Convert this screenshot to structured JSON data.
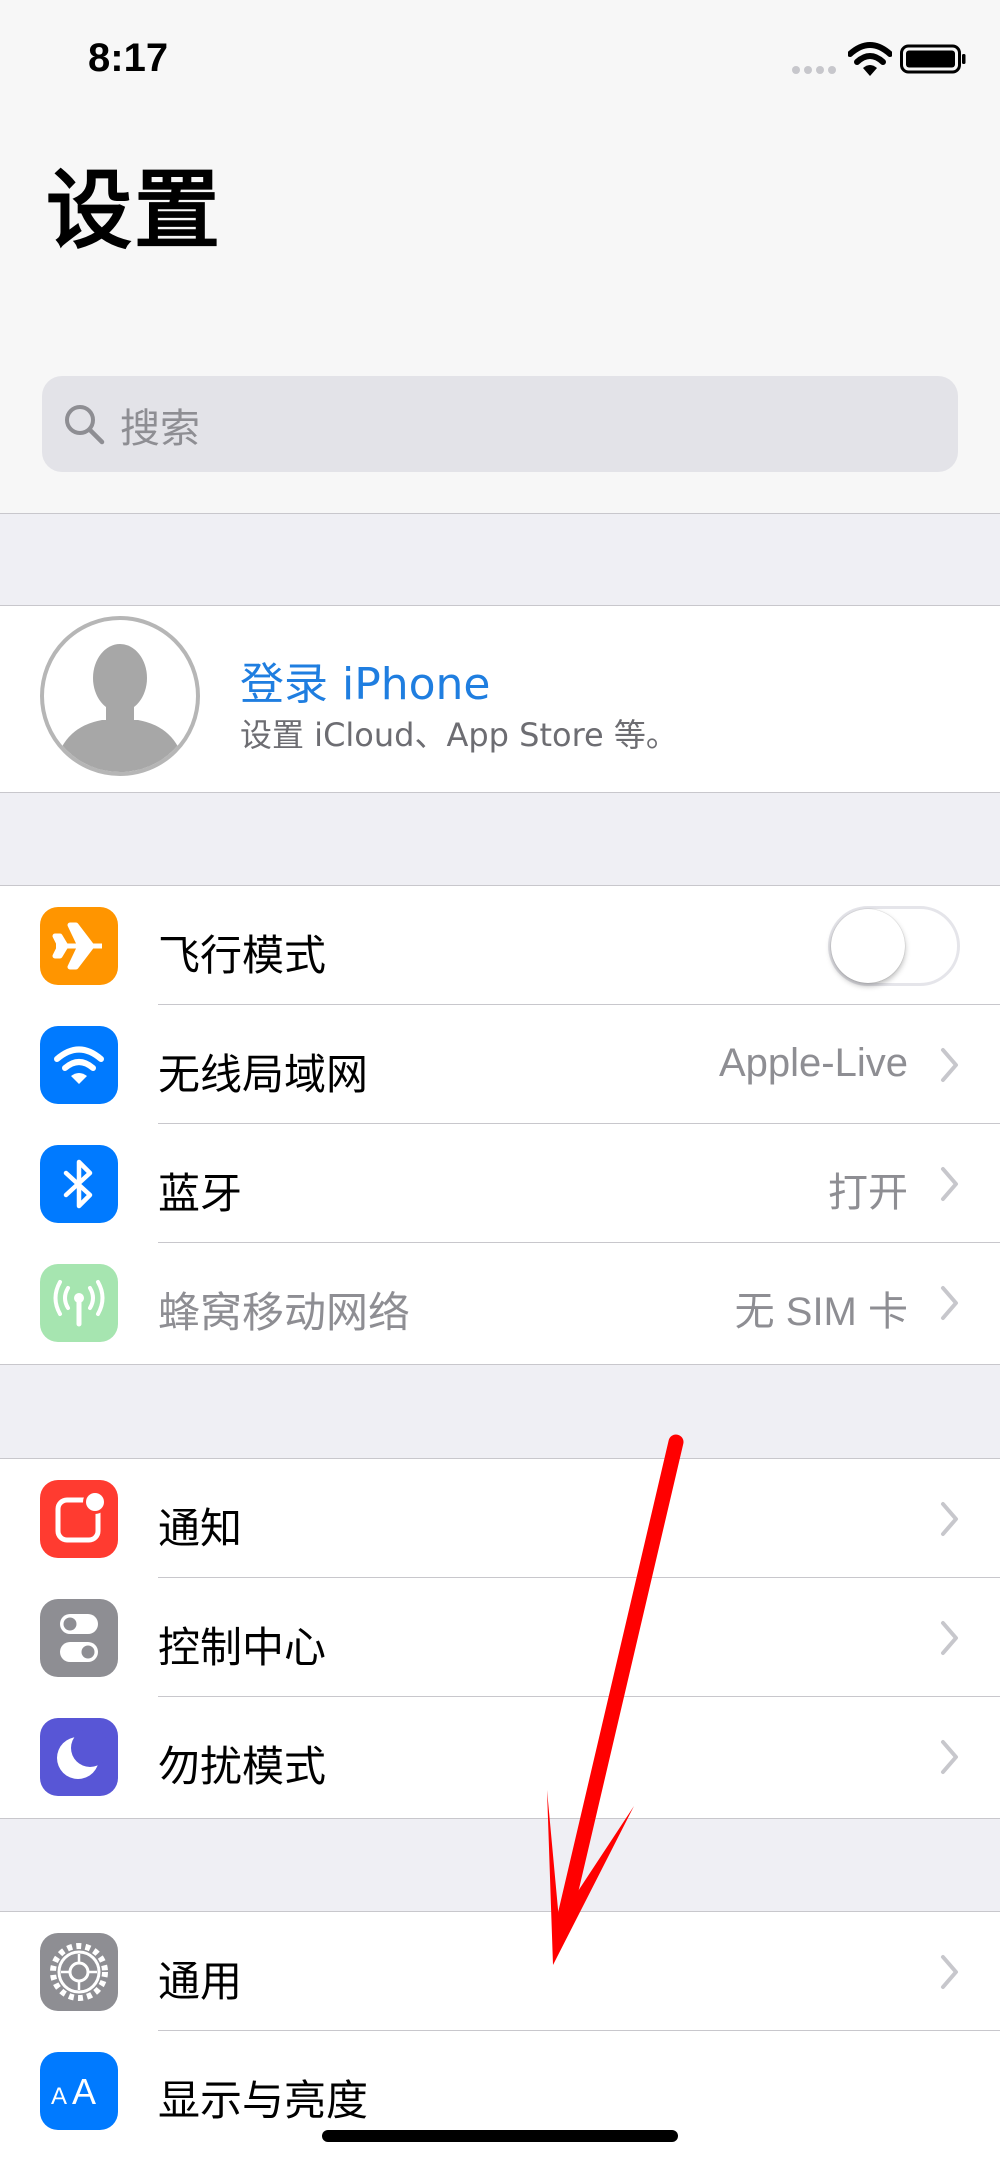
{
  "status_bar": {
    "time": "8:17"
  },
  "header": {
    "title": "设置"
  },
  "search": {
    "placeholder": "搜索"
  },
  "profile": {
    "title": "登录 iPhone",
    "subtitle": "设置 iCloud、App Store 等。"
  },
  "connectivity": [
    {
      "label": "飞行模式",
      "icon": "airplane-icon",
      "color": "#ff9500",
      "toggle_on": false
    },
    {
      "label": "无线局域网",
      "icon": "wifi-icon",
      "color": "#007aff",
      "value": "Apple-Live"
    },
    {
      "label": "蓝牙",
      "icon": "bluetooth-icon",
      "color": "#007aff",
      "value": "打开"
    },
    {
      "label": "蜂窝移动网络",
      "icon": "cellular-icon",
      "color": "#a6e5b0",
      "value": "无 SIM 卡",
      "dimmed": true
    }
  ],
  "alerts": [
    {
      "label": "通知",
      "icon": "notifications-icon",
      "color": "#ff3b30"
    },
    {
      "label": "控制中心",
      "icon": "control-center-icon",
      "color": "#8e8e93"
    },
    {
      "label": "勿扰模式",
      "icon": "moon-icon",
      "color": "#5856d6"
    }
  ],
  "general": [
    {
      "label": "通用",
      "icon": "gear-icon",
      "color": "#8e8e93"
    },
    {
      "label": "显示与亮度",
      "icon": "display-icon",
      "color": "#007aff"
    }
  ],
  "overlay": {
    "arrow_color": "#ff0000"
  }
}
